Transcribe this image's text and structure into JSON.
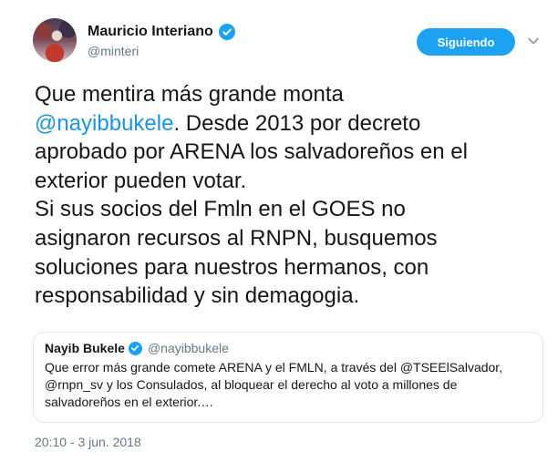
{
  "author": {
    "display_name": "Mauricio Interiano",
    "handle": "@minteri"
  },
  "follow_button": {
    "label": "Siguiendo"
  },
  "tweet": {
    "lines": [
      {
        "text": "Que mentira más grande monta"
      },
      {
        "mention": "@nayibbukele",
        "text": ". Desde 2013 por decreto"
      },
      {
        "text": "aprobado por ARENA los salvadoreños en el"
      },
      {
        "text": "exterior pueden votar."
      },
      {
        "text": "Si sus socios del Fmln en el GOES no"
      },
      {
        "text": "asignaron recursos al RNPN, busquemos"
      },
      {
        "text": "soluciones para nuestros hermanos, con"
      },
      {
        "text": "responsabilidad y sin demagogia."
      }
    ]
  },
  "quoted_tweet": {
    "display_name": "Nayib Bukele",
    "handle": "@nayibbukele",
    "lines": [
      "Que error más grande comete ARENA y el FMLN, a través del @TSEElSalvador,",
      "@rnpn_sv y los Consulados, al bloquear el derecho al voto a millones de",
      "salvadoreños en el exterior.…"
    ]
  },
  "timestamp": "20:10 - 3 jun. 2018",
  "icons": {
    "verified": "verified-badge-icon",
    "menu": "chevron-down-icon"
  },
  "colors": {
    "accent": "#1da1f2",
    "mention": "#1b95e0",
    "text": "#14171a",
    "secondary_text": "#657786",
    "border": "#e1e8ed"
  }
}
